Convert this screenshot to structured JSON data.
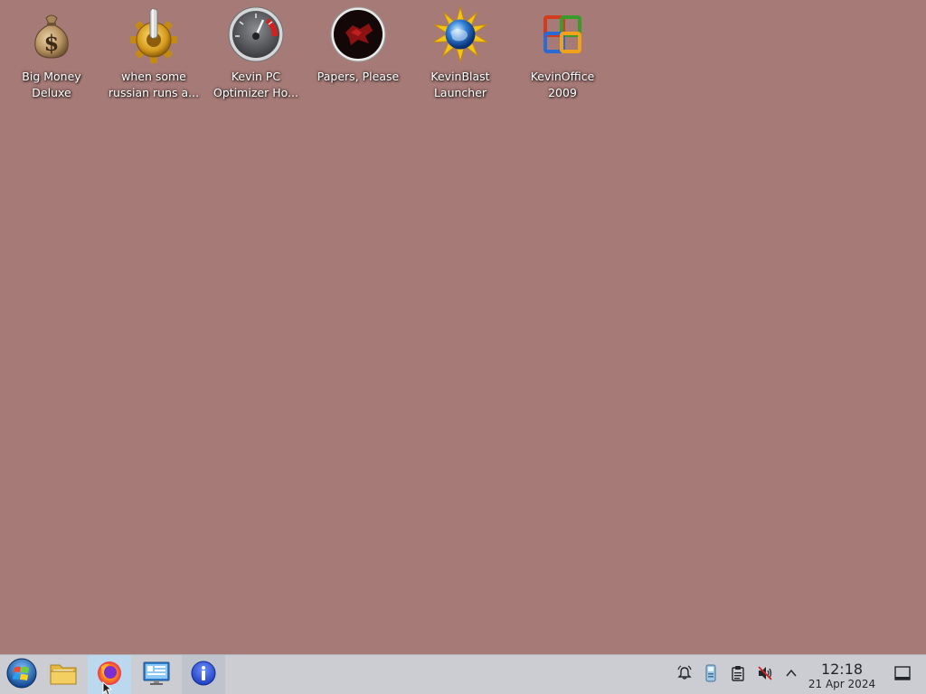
{
  "desktop": {
    "background_color": "#a67a76",
    "icons": [
      {
        "label": "Big Money\nDeluxe",
        "icon": "money-bag-icon"
      },
      {
        "label": "when some\nrussian runs a...",
        "icon": "gear-joystick-icon"
      },
      {
        "label": "Kevin PC\nOptimizer Ho...",
        "icon": "speedometer-icon"
      },
      {
        "label": "Papers, Please",
        "icon": "papers-please-icon"
      },
      {
        "label": "KevinBlast\nLauncher",
        "icon": "globe-burst-icon"
      },
      {
        "label": "KevinOffice\n2009",
        "icon": "office-logo-icon"
      }
    ]
  },
  "taskbar": {
    "background_color": "#cbcdd3",
    "launchers": [
      {
        "name": "start-menu-button",
        "icon": "windows-orb-icon"
      },
      {
        "name": "file-manager-button",
        "icon": "folder-icon"
      },
      {
        "name": "firefox-button",
        "icon": "firefox-icon"
      },
      {
        "name": "system-settings-button",
        "icon": "monitor-settings-icon"
      },
      {
        "name": "info-center-button",
        "icon": "info-icon"
      }
    ],
    "tray": [
      {
        "name": "notifications-tray",
        "icon": "bell-alarm-icon"
      },
      {
        "name": "device-tray",
        "icon": "usb-device-icon"
      },
      {
        "name": "clipboard-tray",
        "icon": "clipboard-icon"
      },
      {
        "name": "volume-tray",
        "icon": "speaker-muted-icon"
      },
      {
        "name": "tray-expander",
        "icon": "chevron-up-icon"
      }
    ],
    "clock": {
      "time": "12:18",
      "date": "21 Apr 2024"
    },
    "show_desktop": {
      "icon": "show-desktop-icon"
    }
  }
}
